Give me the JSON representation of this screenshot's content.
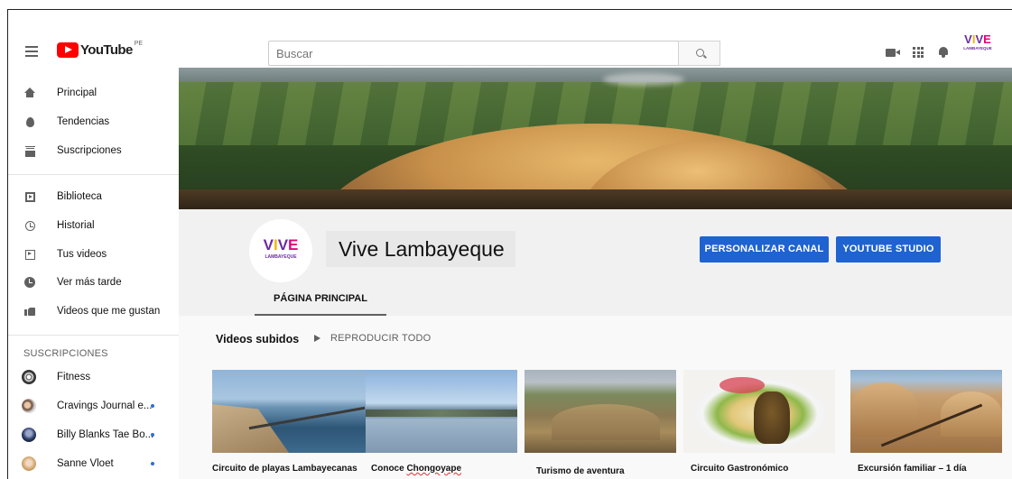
{
  "topbar": {
    "logo_text": "YouTube",
    "country_code": "PE",
    "search_placeholder": "Buscar",
    "icons": [
      "menu-icon",
      "youtube-logo",
      "search-icon",
      "create-video-icon",
      "apps-icon",
      "notifications-icon"
    ],
    "account_logo": {
      "word": "VIVE",
      "sub": "LAMBAYEQUE"
    }
  },
  "sidebar": {
    "main": [
      {
        "label": "Principal",
        "icon": "home-icon"
      },
      {
        "label": "Tendencias",
        "icon": "trending-icon"
      },
      {
        "label": "Suscripciones",
        "icon": "subscriptions-icon"
      }
    ],
    "library": [
      {
        "label": "Biblioteca",
        "icon": "library-icon"
      },
      {
        "label": "Historial",
        "icon": "history-icon"
      },
      {
        "label": "Tus videos",
        "icon": "your-videos-icon"
      },
      {
        "label": "Ver más tarde",
        "icon": "watch-later-icon"
      },
      {
        "label": "Videos que me gustan",
        "icon": "liked-videos-icon"
      }
    ],
    "subscriptions_heading": "SUSCRIPCIONES",
    "subscriptions": [
      {
        "label": "Fitness",
        "has_new": false
      },
      {
        "label": "Cravings Journal e...",
        "has_new": true
      },
      {
        "label": "Billy Blanks Tae Bo...",
        "has_new": true
      },
      {
        "label": "Sanne Vloet",
        "has_new": true
      }
    ]
  },
  "channel": {
    "avatar_logo": {
      "word": "VIVE",
      "sub": "LAMBAYEQUE"
    },
    "name": "Vive Lambayeque",
    "customize_button": "PERSONALIZAR CANAL",
    "studio_button": "YOUTUBE STUDIO",
    "tabs": [
      {
        "label": "PÁGINA PRINCIPAL",
        "active": true
      }
    ]
  },
  "uploads": {
    "section_title": "Videos subidos",
    "play_all_label": "REPRODUCIR TODO",
    "videos": [
      {
        "title": "Circuito de playas Lambayecanas"
      },
      {
        "title_prefix": "Conoce ",
        "title_misspelled": "Chongoyape"
      },
      {
        "title": "Turismo de aventura"
      },
      {
        "title": "Circuito Gastronómico"
      },
      {
        "title": "Excursión familiar – 1 día"
      }
    ]
  },
  "colors": {
    "accent_blue": "#1e63d0",
    "youtube_red": "#ff0000",
    "vive_purple": "#6a2ca0",
    "vive_yellow": "#f2b600",
    "vive_pink": "#e6007e"
  }
}
